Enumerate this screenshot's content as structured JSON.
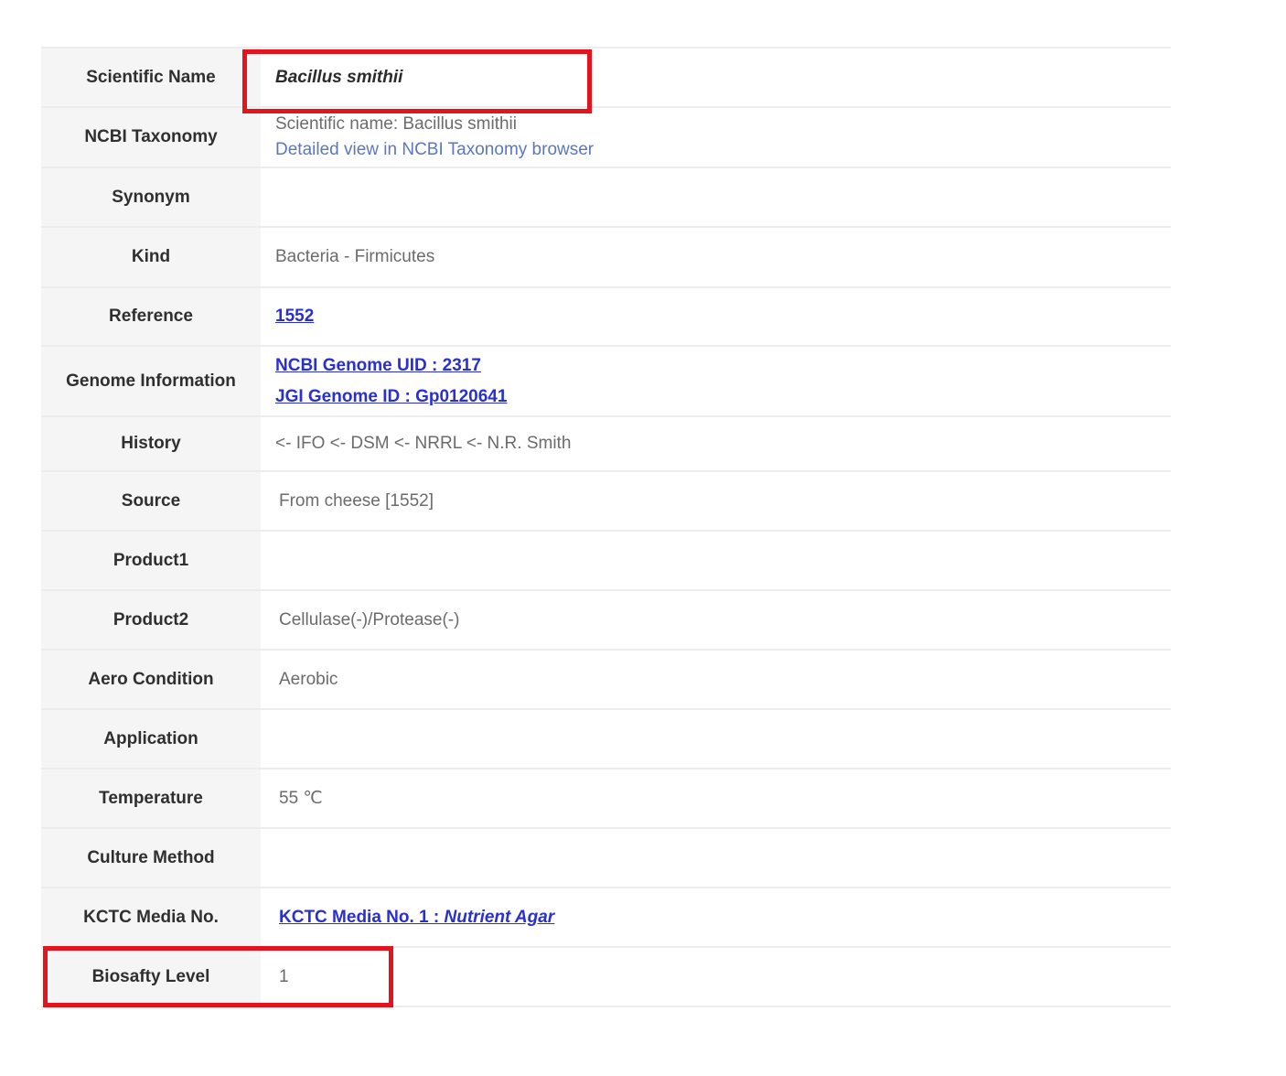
{
  "rows": [
    {
      "label": "Scientific Name",
      "value": "Bacillus smithii"
    },
    {
      "label": "NCBI Taxonomy",
      "value": "Scientific name: Bacillus smithii",
      "link": "Detailed view in NCBI Taxonomy browser"
    },
    {
      "label": "Synonym",
      "value": ""
    },
    {
      "label": "Kind",
      "value": "Bacteria - Firmicutes"
    },
    {
      "label": "Reference",
      "link": "1552"
    },
    {
      "label": "Genome Information",
      "links": [
        "NCBI Genome UID : 2317",
        "JGI Genome ID : Gp0120641"
      ]
    },
    {
      "label": "History",
      "value": "<- IFO <- DSM <- NRRL <- N.R. Smith"
    },
    {
      "label": "Source",
      "value": "From cheese [1552]"
    },
    {
      "label": "Product1",
      "value": ""
    },
    {
      "label": "Product2",
      "value": "Cellulase(-)/Protease(-)"
    },
    {
      "label": "Aero Condition",
      "value": "Aerobic"
    },
    {
      "label": "Application",
      "value": ""
    },
    {
      "label": "Temperature",
      "value": "55 ℃"
    },
    {
      "label": "Culture Method",
      "value": ""
    },
    {
      "label": "KCTC Media No.",
      "link_prefix": "KCTC Media No. 1 : ",
      "link_name": "Nutrient Agar"
    },
    {
      "label": "Biosafty Level",
      "value": "1"
    }
  ],
  "colors": {
    "highlight": "#e3141e",
    "link": "#2a2fd0",
    "label_bg": "#f5f5f5"
  }
}
